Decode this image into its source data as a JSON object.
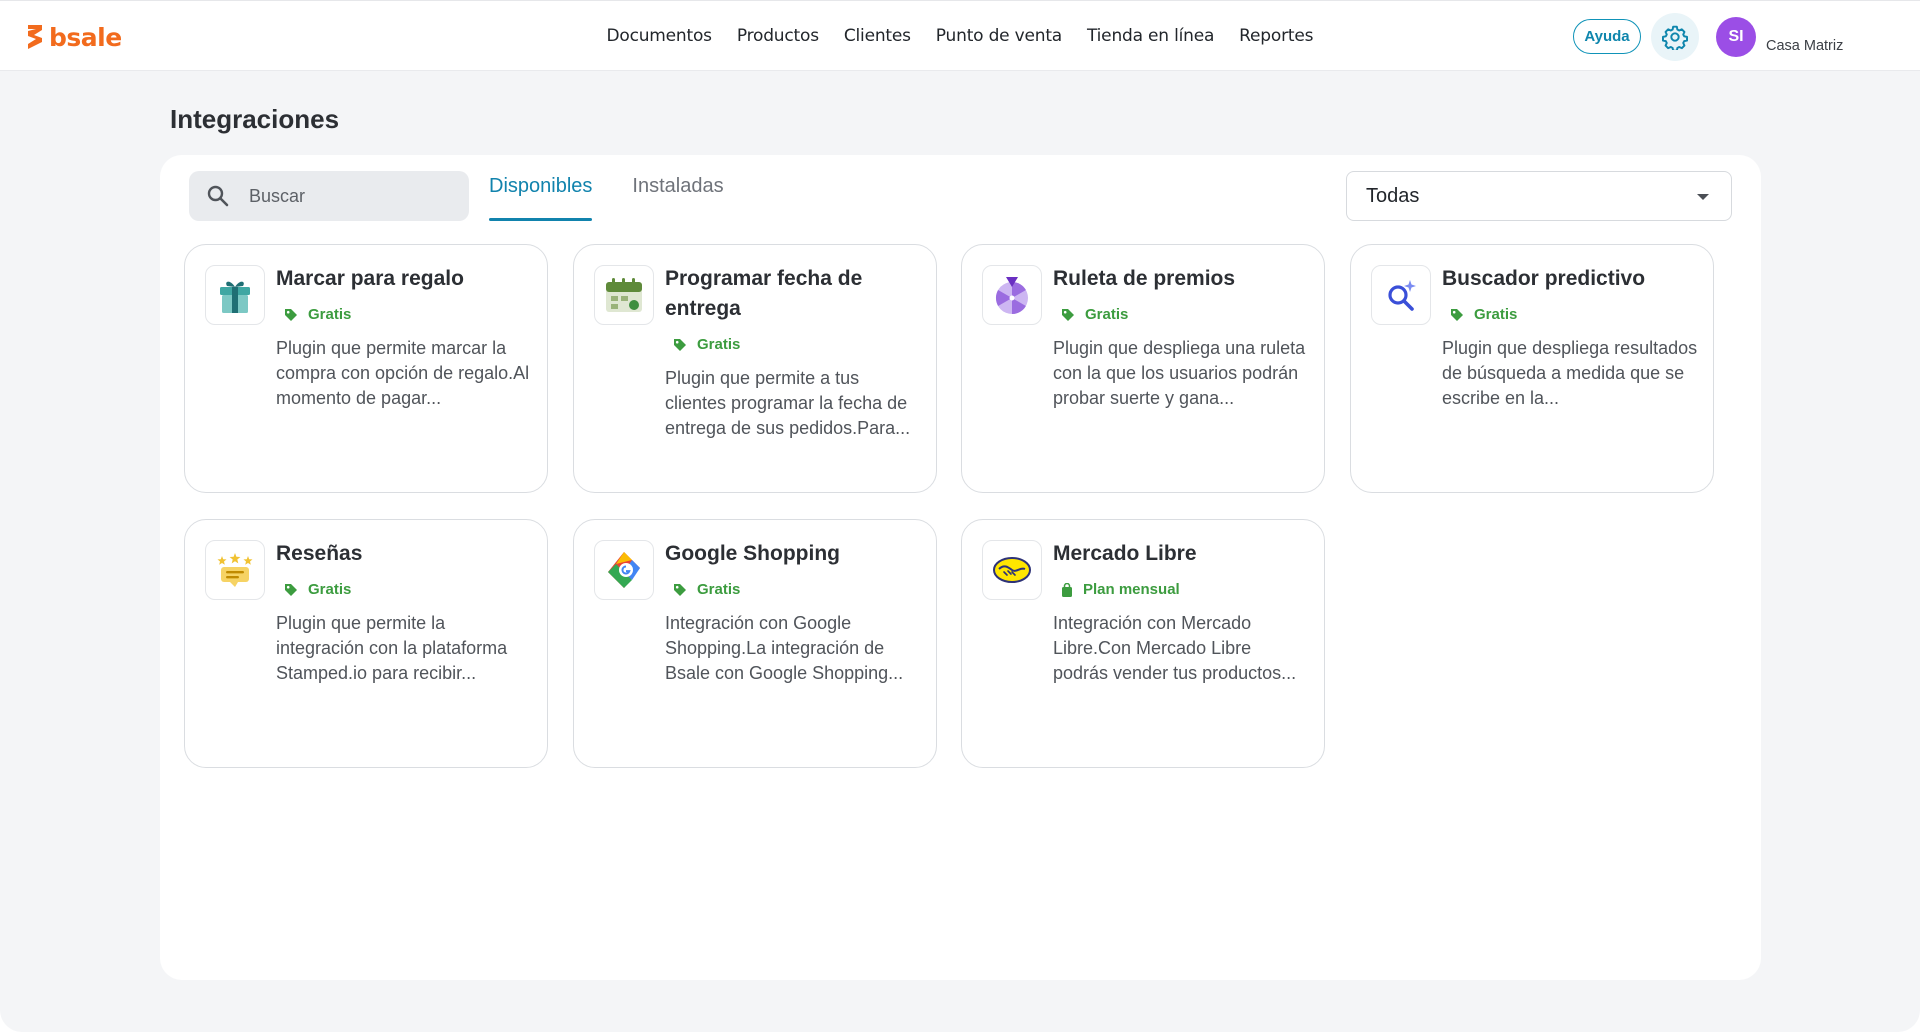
{
  "header": {
    "brand": "bsale",
    "nav": [
      "Documentos",
      "Productos",
      "Clientes",
      "Punto de venta",
      "Tienda en línea",
      "Reportes"
    ],
    "help_label": "Ayuda",
    "user_initials": "SI",
    "branch_name": "Casa Matriz"
  },
  "page": {
    "title": "Integraciones",
    "search_placeholder": "Buscar",
    "tabs": [
      {
        "label": "Disponibles",
        "active": true
      },
      {
        "label": "Instaladas",
        "active": false
      }
    ],
    "category_filter": "Todas"
  },
  "cards": [
    {
      "title": "Marcar para regalo",
      "badge": "Gratis",
      "badge_icon": "tag-icon",
      "icon": "gift-icon",
      "description": "Plugin que permite marcar la compra con opción de regalo.Al momento de pagar..."
    },
    {
      "title": "Programar fecha de entrega",
      "badge": "Gratis",
      "badge_icon": "tag-icon",
      "icon": "calendar-icon",
      "description": "Plugin que permite a tus clientes programar la fecha de entrega de sus pedidos.Para..."
    },
    {
      "title": "Ruleta de premios",
      "badge": "Gratis",
      "badge_icon": "tag-icon",
      "icon": "prize-wheel-icon",
      "description": "Plugin que despliega una ruleta con la que los usuarios podrán probar suerte y gana..."
    },
    {
      "title": "Buscador predictivo",
      "badge": "Gratis",
      "badge_icon": "tag-icon",
      "icon": "predictive-search-icon",
      "description": "Plugin que despliega resultados de búsqueda a medida que se escribe en la..."
    },
    {
      "title": "Reseñas",
      "badge": "Gratis",
      "badge_icon": "tag-icon",
      "icon": "reviews-icon",
      "description": "Plugin que permite la integración con la plataforma Stamped.io para recibir..."
    },
    {
      "title": "Google Shopping",
      "badge": "Gratis",
      "badge_icon": "tag-icon",
      "icon": "google-shopping-icon",
      "description": "Integración con Google Shopping.La integración de Bsale con Google Shopping..."
    },
    {
      "title": "Mercado Libre",
      "badge": "Plan mensual",
      "badge_icon": "shopping-bag-icon",
      "icon": "mercado-libre-icon",
      "description": "Integración con Mercado Libre.Con Mercado Libre podrás vender tus productos..."
    }
  ],
  "colors": {
    "brand_orange": "#f26b1d",
    "accent_blue": "#1183ad",
    "badge_green": "#3c9c3f",
    "avatar_purple": "#9b4ee6",
    "page_bg": "#f4f5f7"
  }
}
